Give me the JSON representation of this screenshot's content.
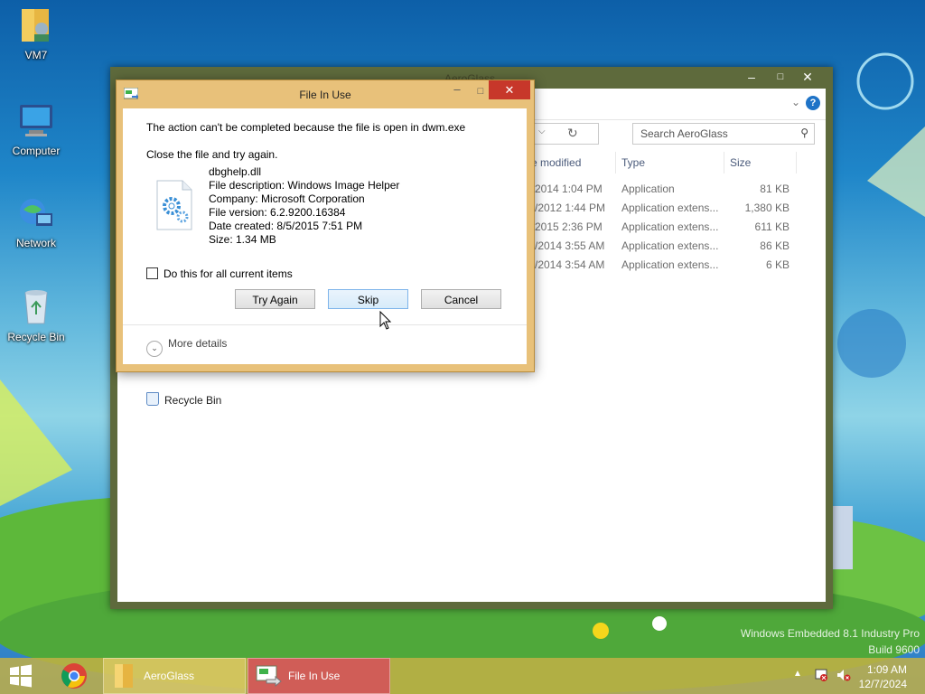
{
  "desktop": {
    "icons": [
      {
        "label": "VM7"
      },
      {
        "label": "Computer"
      },
      {
        "label": "Network"
      },
      {
        "label": "Recycle Bin"
      }
    ],
    "watermark": {
      "line1": "Windows Embedded 8.1 Industry Pro",
      "line2": "Build 9600"
    }
  },
  "explorer": {
    "title": "AeroGlass",
    "search_placeholder": "Search AeroGlass",
    "columns": [
      "e modified",
      "Type",
      "Size"
    ],
    "rows": [
      {
        "date": "2014 1:04 PM",
        "type": "Application",
        "size": "81 KB"
      },
      {
        "date": "/2012 1:44 PM",
        "type": "Application extens...",
        "size": "1,380 KB"
      },
      {
        "date": "2015 2:36 PM",
        "type": "Application extens...",
        "size": "611 KB"
      },
      {
        "date": "/2014 3:55 AM",
        "type": "Application extens...",
        "size": "86 KB"
      },
      {
        "date": "/2014 3:54 AM",
        "type": "Application extens...",
        "size": "6 KB"
      }
    ],
    "nav_recycle": "Recycle Bin"
  },
  "dialog": {
    "title": "File In Use",
    "message": "The action can't be completed because the file is open in dwm.exe",
    "instruction": "Close the file and try again.",
    "file": {
      "name": "dbghelp.dll",
      "description": "File description: Windows Image Helper",
      "company": "Company: Microsoft Corporation",
      "version": "File version: 6.2.9200.16384",
      "created": "Date created: 8/5/2015 7:51 PM",
      "size": "Size: 1.34 MB"
    },
    "checkbox_label": "Do this for all current items",
    "checkbox_checked": false,
    "buttons": {
      "try_again": "Try Again",
      "skip": "Skip",
      "cancel": "Cancel"
    },
    "more_details": "More details"
  },
  "taskbar": {
    "items": [
      {
        "label": "AeroGlass"
      },
      {
        "label": "File In Use"
      }
    ],
    "time": "1:09 AM",
    "date": "12/7/2024"
  }
}
